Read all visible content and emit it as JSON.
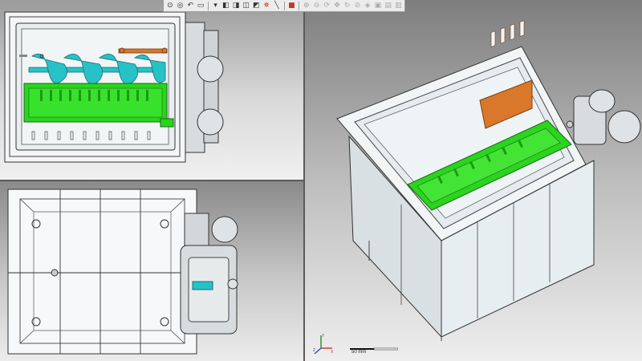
{
  "toolbar": {
    "buttons": [
      {
        "name": "zoom-to-fit-icon",
        "glyph": "⊙"
      },
      {
        "name": "zoom-area-icon",
        "glyph": "◎"
      },
      {
        "name": "previous-view-icon",
        "glyph": "↶"
      },
      {
        "name": "section-view-icon",
        "glyph": "▭"
      },
      {
        "name": "dynamic-annotation-icon",
        "glyph": "▾"
      },
      {
        "name": "view-orientation-icon",
        "glyph": "◧"
      },
      {
        "name": "display-style-icon",
        "glyph": "◨"
      },
      {
        "name": "hide-show-items-icon",
        "glyph": "◫"
      },
      {
        "name": "edit-appearance-icon",
        "glyph": "◩"
      },
      {
        "name": "apply-scene-icon",
        "glyph": "⛯"
      },
      {
        "name": "view-settings-icon",
        "glyph": "╲"
      },
      {
        "name": "realview-icon",
        "glyph": "■"
      },
      {
        "name": "zoom-in-icon",
        "glyph": "⊕"
      },
      {
        "name": "zoom-out-icon",
        "glyph": "⊖"
      },
      {
        "name": "rotate-view-icon",
        "glyph": "⟳"
      },
      {
        "name": "pan-icon",
        "glyph": "✥"
      },
      {
        "name": "roll-view-icon",
        "glyph": "↻"
      },
      {
        "name": "normal-to-icon",
        "glyph": "⊘"
      },
      {
        "name": "view-cube-icon",
        "glyph": "◈"
      },
      {
        "name": "camera-icon",
        "glyph": "▣"
      },
      {
        "name": "screenshot-icon",
        "glyph": "▤"
      },
      {
        "name": "options-icon",
        "glyph": "▥"
      }
    ],
    "accent": "#c0392b"
  },
  "scale": {
    "label": "50 mm"
  },
  "colors": {
    "auger": "#27c2c8",
    "trough": "#2bd41f",
    "bracket": "#d9782a",
    "housing": "#e7ecee",
    "outline": "#2a2a2a"
  }
}
